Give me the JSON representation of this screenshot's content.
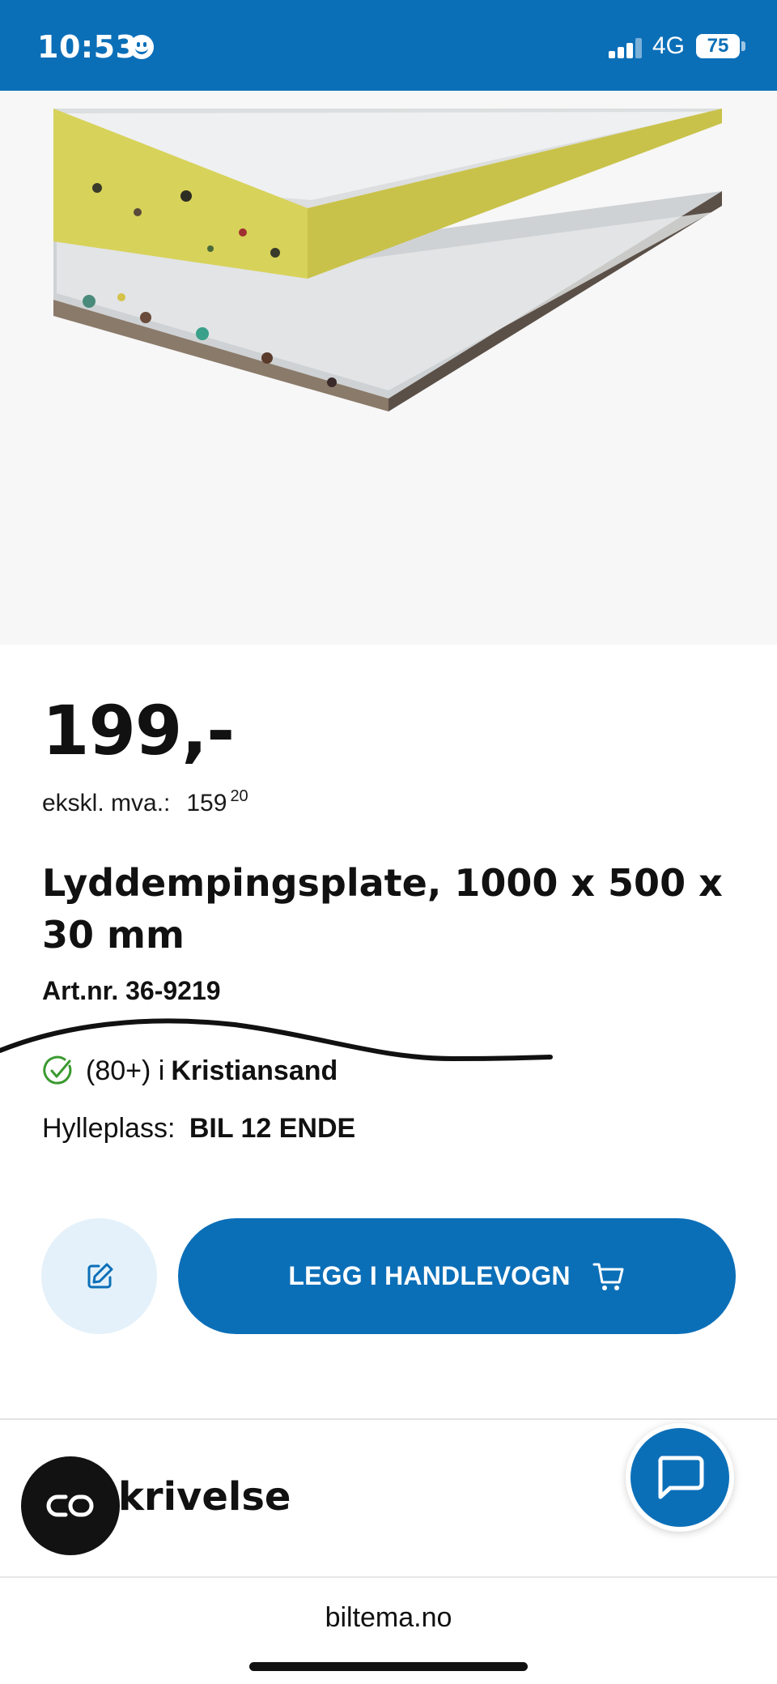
{
  "status_bar": {
    "time": "10:53",
    "network": "4G",
    "battery": "75"
  },
  "product": {
    "price": "199,-",
    "excl_vat_label": "ekskl. mva.:",
    "excl_vat_main": "159",
    "excl_vat_decimals": "20",
    "title": "Lyddempingsplate, 1000 x 500 x 30 mm",
    "article_number": "Art.nr. 36-9219",
    "stock_text": "(80+) i",
    "stock_store": "Kristiansand",
    "shelf_label": "Hylleplass:",
    "shelf_value": "BIL 12 ENDE"
  },
  "actions": {
    "add_to_cart_label": "LEGG I HANDLEVOGN"
  },
  "section": {
    "description_heading_visible": "krivelse"
  },
  "browser": {
    "url": "biltema.no"
  },
  "colors": {
    "brand_blue": "#0b6fb8",
    "light_blue": "#e4f1fa",
    "check_green": "#3a9a2f"
  },
  "icons": [
    "smiley-icon",
    "signal-icon",
    "battery-icon",
    "check-circle-icon",
    "edit-note-icon",
    "cart-icon",
    "chat-bubble-icon",
    "co-link-icon"
  ]
}
